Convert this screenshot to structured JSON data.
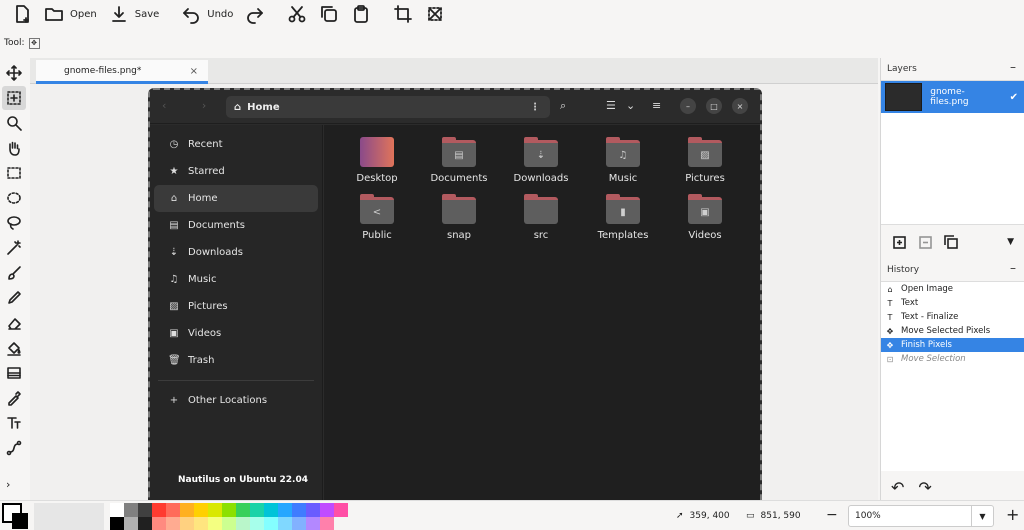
{
  "toolbar": {
    "open_label": "Open",
    "save_label": "Save",
    "undo_label": "Undo"
  },
  "tool_row": {
    "label": "Tool:"
  },
  "document": {
    "tab_title": "gnome-files.png*",
    "close_glyph": "×"
  },
  "nautilus": {
    "path_title": "Home",
    "sidebar": [
      {
        "icon": "clock-icon",
        "glyph": "◷",
        "label": "Recent"
      },
      {
        "icon": "star-icon",
        "glyph": "★",
        "label": "Starred"
      },
      {
        "icon": "home-icon",
        "glyph": "⌂",
        "label": "Home",
        "active": true
      },
      {
        "icon": "document-icon",
        "glyph": "▤",
        "label": "Documents"
      },
      {
        "icon": "download-icon",
        "glyph": "⇣",
        "label": "Downloads"
      },
      {
        "icon": "music-icon",
        "glyph": "♫",
        "label": "Music"
      },
      {
        "icon": "pictures-icon",
        "glyph": "▨",
        "label": "Pictures"
      },
      {
        "icon": "videos-icon",
        "glyph": "▣",
        "label": "Videos"
      },
      {
        "icon": "trash-icon",
        "glyph": "🗑",
        "label": "Trash"
      }
    ],
    "other_locations": "Other Locations",
    "credit_text": "Nautilus on Ubuntu 22.04",
    "folders": [
      {
        "label": "Desktop",
        "glyph": "",
        "desktop": true
      },
      {
        "label": "Documents",
        "glyph": "▤"
      },
      {
        "label": "Downloads",
        "glyph": "⇣"
      },
      {
        "label": "Music",
        "glyph": "♫"
      },
      {
        "label": "Pictures",
        "glyph": "▨"
      },
      {
        "label": "Public",
        "glyph": "<"
      },
      {
        "label": "snap",
        "glyph": ""
      },
      {
        "label": "src",
        "glyph": ""
      },
      {
        "label": "Templates",
        "glyph": "▮"
      },
      {
        "label": "Videos",
        "glyph": "▣"
      }
    ]
  },
  "layers": {
    "title": "Layers",
    "items": [
      {
        "name": "gnome-files.png",
        "visible": true
      }
    ]
  },
  "history": {
    "title": "History",
    "items": [
      {
        "label": "Open Image",
        "glyph": "⌂",
        "state": "normal"
      },
      {
        "label": "Text",
        "glyph": "T",
        "state": "normal"
      },
      {
        "label": "Text - Finalize",
        "glyph": "T",
        "state": "normal"
      },
      {
        "label": "Move Selected Pixels",
        "glyph": "✥",
        "state": "normal"
      },
      {
        "label": "Finish Pixels",
        "glyph": "✥",
        "state": "active"
      },
      {
        "label": "Move Selection",
        "glyph": "⊡",
        "state": "dim"
      }
    ]
  },
  "status": {
    "cursor_position": "359, 400",
    "selection_size": "851, 590",
    "zoom": "100%"
  },
  "palette": [
    "#ffffff",
    "#808080",
    "#404040",
    "#ff3b30",
    "#ff6b5a",
    "#ffb020",
    "#ffd000",
    "#d9e800",
    "#8ce000",
    "#38d05a",
    "#1ad3a8",
    "#00c4d8",
    "#26a7ff",
    "#3f7cff",
    "#6a5cff",
    "#c04cff",
    "#ff4fa6",
    "#000000",
    "#b0b0b0",
    "#202020",
    "#ff8a80",
    "#ffab91",
    "#ffd180",
    "#ffe57f",
    "#f4ff81",
    "#ccff90",
    "#b9f6ca",
    "#a7ffeb",
    "#84ffff",
    "#80d8ff",
    "#82b1ff",
    "#b388ff",
    "#ff80ab"
  ]
}
